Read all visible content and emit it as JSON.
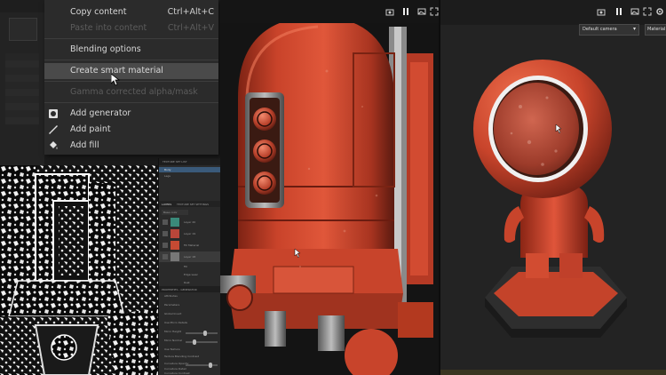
{
  "context_menu": {
    "items": [
      {
        "label": "Copy content",
        "shortcut": "Ctrl+Alt+C",
        "disabled": false
      },
      {
        "label": "Paste into content",
        "shortcut": "Ctrl+Alt+V",
        "disabled": true
      },
      {
        "label": "Blending options",
        "shortcut": "",
        "disabled": false
      },
      {
        "label": "Create smart material",
        "shortcut": "",
        "disabled": false,
        "highlighted": true
      },
      {
        "label": "Gamma corrected alpha/mask",
        "shortcut": "",
        "disabled": true
      },
      {
        "label": "Add generator",
        "shortcut": "",
        "disabled": false,
        "icon": "generator-icon"
      },
      {
        "label": "Add paint",
        "shortcut": "",
        "disabled": false,
        "icon": "paint-brush-icon"
      },
      {
        "label": "Add fill",
        "shortcut": "",
        "disabled": false,
        "icon": "fill-bucket-icon"
      }
    ]
  },
  "layer_panel": {
    "header": "TEXTURE SET LIST",
    "texture_sets": [
      "Body",
      "Legs"
    ],
    "tabs": [
      "LAYERS",
      "TEXTURE SET SETTINGS"
    ],
    "blend_label": "Base color",
    "layers": [
      "Layer 20",
      "Layer 19",
      "Fill Material",
      "Layer 18",
      "Fill",
      "Edge wear",
      "Rust"
    ],
    "properties_header": "PROPERTIES - GENERATOR",
    "properties": [
      "Attributes",
      "Parameters",
      "Global Invert",
      "Use Micro Details",
      "Micro Height",
      "Micro Normal",
      "Use Texture",
      "Texture Blending Contrast",
      "Curvature Opacity",
      "Curvature Detail",
      "Curvature Contrast"
    ]
  },
  "right_view": {
    "camera": "Default camera",
    "channel": "Material"
  },
  "icons": {
    "center_toolbar": [
      "camera-icon",
      "pause-icon",
      "screenshot-icon",
      "fullscreen-icon"
    ],
    "right_toolbar": [
      "camera-icon",
      "pause-icon",
      "screenshot-icon",
      "fullscreen-icon",
      "settings-icon"
    ]
  },
  "colors": {
    "menu_bg": "#2b2b2b",
    "menu_highlight": "#4a4a4a",
    "robot_orange": "#d4432a",
    "viewport_bg": "#141414"
  }
}
